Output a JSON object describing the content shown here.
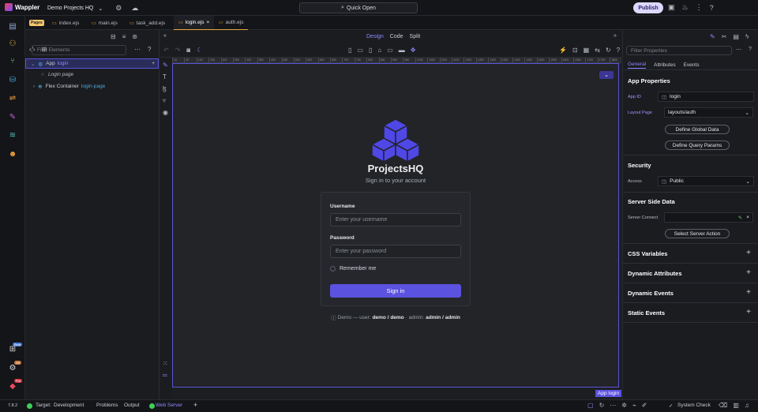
{
  "app": {
    "name": "Wappler",
    "project": "Demo Projects HQ",
    "publish_label": "Publish"
  },
  "quick_open": {
    "label": "Quick Open"
  },
  "rail": {
    "badges": {
      "beta": "Beta",
      "on": "On",
      "pro": "Pro"
    }
  },
  "tabs": {
    "pages_badge": "Pages",
    "items": [
      "index.ejs",
      "main.ejs",
      "task_add.ejs",
      "login.ejs",
      "auth.ejs"
    ],
    "close_glyph": "×"
  },
  "left": {
    "find_placeholder": "Find Elements",
    "tree": [
      {
        "label": "App",
        "id": "login"
      },
      {
        "label": "Login page"
      },
      {
        "label": "Flex Container",
        "id": "login-page"
      }
    ]
  },
  "design": {
    "modes": [
      "Design",
      "Code",
      "Split"
    ],
    "active_mode": "Design"
  },
  "ruler": {
    "marks": [
      "10",
      "50",
      "100",
      "150",
      "200",
      "250",
      "300",
      "350",
      "400",
      "450",
      "500",
      "550",
      "600",
      "650",
      "700",
      "750",
      "800",
      "850",
      "900",
      "950",
      "1000",
      "1050",
      "1100",
      "1150",
      "1200",
      "1250",
      "1300",
      "1350",
      "1400",
      "1450",
      "1500",
      "1550",
      "1600",
      "1650",
      "1700",
      "1750",
      "1800"
    ]
  },
  "page": {
    "brand": "ProjectsHQ",
    "tagline": "Sign in to your account",
    "username_label": "Username",
    "username_placeholder": "Enter your username",
    "password_label": "Password",
    "password_placeholder": "Enter your password",
    "remember_label": "Remember me",
    "signin_label": "Sign in",
    "demo": {
      "prefix": "Demo — user:",
      "user": "demo / demo",
      "mid": "· admin:",
      "admin": "admin / admin"
    }
  },
  "selection_tag": "App login",
  "right": {
    "filter_placeholder": "Filter Properties",
    "tabs": [
      "General",
      "Attributes",
      "Events"
    ],
    "active_tab": "General",
    "app_properties": {
      "title": "App Properties",
      "app_id_label": "App ID",
      "app_id_value": "login",
      "layout_label": "Layout Page",
      "layout_value": "layouts/auth",
      "define_global": "Define Global Data",
      "define_query": "Define Query Params"
    },
    "security": {
      "title": "Security",
      "access_label": "Access",
      "access_value": "Public"
    },
    "server_side": {
      "title": "Server Side Data",
      "connect_label": "Server Connect",
      "select_action": "Select Server Action"
    },
    "sections": [
      "CSS Variables",
      "Dynamic Attributes",
      "Dynamic Events",
      "Static Events"
    ]
  },
  "status": {
    "version": "7.8.2",
    "target_label": "Target:",
    "target_value": "Development",
    "problems": "Problems",
    "output": "Output",
    "webserver": "Web Server",
    "system_check": "System Check"
  },
  "colors": {
    "accent": "#5b52e0",
    "brand_blue": "#4f47e6",
    "status_green": "#3ecf5a"
  }
}
